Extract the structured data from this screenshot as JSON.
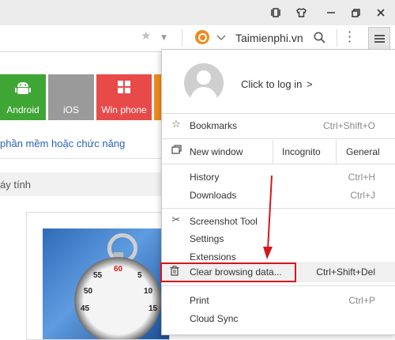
{
  "toolbar": {
    "search_engine": "Taimienphi.vn"
  },
  "tiles": [
    {
      "label": "Android",
      "icon": "android-icon",
      "color": "#3fa535"
    },
    {
      "label": "iOS",
      "icon": "apple-icon",
      "color": "#9a9a9a"
    },
    {
      "label": "Win phone",
      "icon": "windows-icon",
      "color": "#e84a4a"
    }
  ],
  "page": {
    "link_text": "phần mềm hoặc chức năng",
    "section_title": "áy tính",
    "watch_numbers": [
      "60",
      "55",
      "5",
      "50",
      "10",
      "45",
      "15"
    ]
  },
  "menu": {
    "login": "Click to log in",
    "login_arrow": ">",
    "bookmarks": {
      "label": "Bookmarks",
      "shortcut": "Ctrl+Shift+O"
    },
    "new_window": {
      "label": "New window",
      "incognito": "Incognito",
      "general": "General"
    },
    "history": {
      "label": "History",
      "shortcut": "Ctrl+H"
    },
    "downloads": {
      "label": "Downloads",
      "shortcut": "Ctrl+J"
    },
    "screenshot": {
      "label": "Screenshot Tool"
    },
    "settings": {
      "label": "Settings"
    },
    "extensions": {
      "label": "Extensions"
    },
    "clear": {
      "label": "Clear browsing data...",
      "shortcut": "Ctrl+Shift+Del"
    },
    "print": {
      "label": "Print",
      "shortcut": "Ctrl+P"
    },
    "cloud_sync": {
      "label": "Cloud Sync"
    }
  },
  "colors": {
    "highlight_box": "#d6161c",
    "search_logo": "#f08a1c",
    "link": "#2a62b5"
  }
}
